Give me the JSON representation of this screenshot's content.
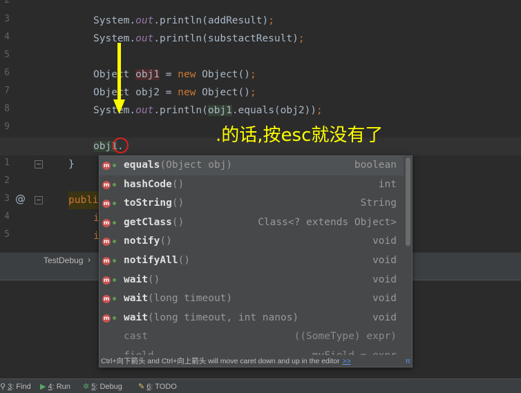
{
  "editor": {
    "gutter_numbers": [
      "2",
      "3",
      "4",
      "5",
      "6",
      "7",
      "8",
      "9",
      "0",
      "1",
      "2",
      "3",
      "4",
      "5"
    ],
    "lines": {
      "l3": {
        "a": "System.",
        "b": "out",
        "c": ".println(addResult)",
        "d": ";"
      },
      "l4": {
        "a": "System.",
        "b": "out",
        "c": ".println(substactResult)",
        "d": ";"
      },
      "l6": {
        "a": "Object ",
        "b": "obj1",
        "c": " = ",
        "d": "new ",
        "e": "Object()",
        "f": ";"
      },
      "l7": {
        "a": "Object obj2 = ",
        "b": "new ",
        "c": "Object()",
        "d": ";"
      },
      "l8": {
        "a": "System.",
        "b": "out",
        "c": ".println(",
        "d": "obj1",
        "e": ".equals(obj2))",
        "f": ";"
      },
      "l10": {
        "a": "obj1",
        "b": "."
      },
      "l11": {
        "a": "}"
      },
      "l13": {
        "a": "publi"
      },
      "l14": {
        "a": "i"
      },
      "l15": {
        "a": "i"
      }
    },
    "gutter_at_icon": "@"
  },
  "annotation": {
    "text": ".的话,按esc就没有了",
    "color": "#ffff00"
  },
  "completion": {
    "items": [
      {
        "name": "equals",
        "params": "(Object obj)",
        "type": "boolean",
        "selected": true
      },
      {
        "name": "hashCode",
        "params": "()",
        "type": "int"
      },
      {
        "name": "toString",
        "params": "()",
        "type": "String"
      },
      {
        "name": "getClass",
        "params": "()",
        "type": "Class<? extends Object>"
      },
      {
        "name": "notify",
        "params": "()",
        "type": "void"
      },
      {
        "name": "notifyAll",
        "params": "()",
        "type": "void"
      },
      {
        "name": "wait",
        "params": "()",
        "type": "void"
      },
      {
        "name": "wait",
        "params": "(long timeout)",
        "type": "void"
      },
      {
        "name": "wait",
        "params": "(long timeout, int nanos)",
        "type": "void"
      },
      {
        "name": "cast",
        "params": "",
        "type": "((SomeType) expr)",
        "dim": true
      },
      {
        "name": "field",
        "params": "",
        "type": "myField = expr",
        "dim": true
      }
    ],
    "method_icon": "m",
    "hint_text": "Ctrl+向下箭头 and Ctrl+向上箭头 will move caret down and up in the editor",
    "hint_link": ">>",
    "hint_pi": "π"
  },
  "breadcrumb": {
    "item": "TestDebug",
    "sep": "›"
  },
  "toolbar": {
    "find_num": "3",
    "find": ": Find",
    "run_num": "4",
    "run": ": Run",
    "debug_num": "5",
    "debug": ": Debug",
    "todo_num": "6",
    "todo": ": TODO"
  },
  "colors": {
    "background": "#2b2b2b",
    "keyword": "#cc7832",
    "field": "#9876aa",
    "text": "#a9b7c6",
    "annotation": "#ffff00",
    "circle": "#e02020"
  }
}
